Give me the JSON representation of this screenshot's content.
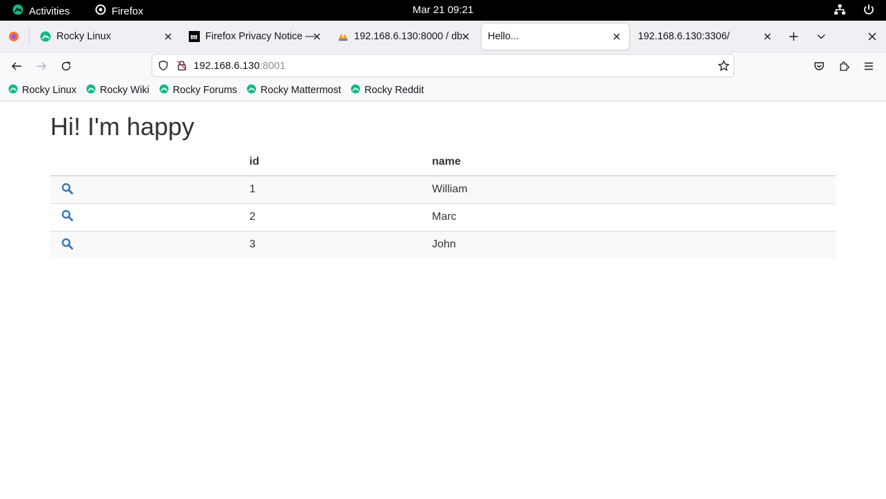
{
  "topbar": {
    "activities": "Activities",
    "app_name": "Firefox",
    "clock": "Mar 21  09:21"
  },
  "tabs": [
    {
      "label": "Rocky Linux",
      "favicon": "rocky-icon",
      "active": false
    },
    {
      "label": "Firefox Privacy Notice —",
      "favicon": "mozilla-icon",
      "active": false
    },
    {
      "label": "192.168.6.130:8000 / db",
      "favicon": "phpmyadmin-icon",
      "active": false
    },
    {
      "label": "Hello...",
      "favicon": "",
      "active": true
    },
    {
      "label": "192.168.6.130:3306/",
      "favicon": "",
      "active": false
    }
  ],
  "urlbar": {
    "host": "192.168.6.130",
    "port": ":8001"
  },
  "bookmarks": [
    {
      "label": "Rocky Linux"
    },
    {
      "label": "Rocky Wiki"
    },
    {
      "label": "Rocky Forums"
    },
    {
      "label": "Rocky Mattermost"
    },
    {
      "label": "Rocky Reddit"
    }
  ],
  "page": {
    "heading": "Hi! I'm happy",
    "table": {
      "headers": [
        "",
        "id",
        "name"
      ],
      "rows": [
        {
          "id": "1",
          "name": "William"
        },
        {
          "id": "2",
          "name": "Marc"
        },
        {
          "id": "3",
          "name": "John"
        }
      ]
    }
  },
  "colors": {
    "rocky_green": "#10b981",
    "search_icon": "#337ab7"
  }
}
